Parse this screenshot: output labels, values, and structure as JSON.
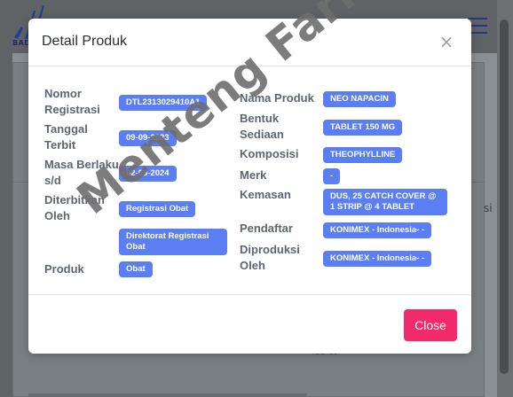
{
  "background": {
    "logo_text": "BAD",
    "side_text": "si",
    "footer_text": "Tablet"
  },
  "modal": {
    "title": "Detail Produk",
    "close_x": "×",
    "close_button": "Close"
  },
  "left_fields": [
    {
      "label": "Nomor Registrasi",
      "value": "DTL2313029410A1"
    },
    {
      "label": "Tanggal Terbit",
      "value": "09-09-2023"
    },
    {
      "label": "Masa Berlaku s/d",
      "value": "02-06-2024"
    },
    {
      "label": "Diterbitkan Oleh",
      "value": "Registrasi Obat",
      "value2": "Direktorat Registrasi Obat"
    },
    {
      "label": "Produk",
      "value": "Obat"
    }
  ],
  "right_fields": [
    {
      "label": "Nama Produk",
      "value": "NEO NAPACIN"
    },
    {
      "label": "Bentuk Sediaan",
      "value": "TABLET 150 MG"
    },
    {
      "label": "Komposisi",
      "value": "THEOPHYLLINE"
    },
    {
      "label": "Merk",
      "value": "-"
    },
    {
      "label": "Kemasan",
      "value": "DUS, 25 CATCH COVER @ 1 STRIP @ 4 TABLET"
    },
    {
      "label": "Pendaftar",
      "value": "KONIMEX - Indonesia- -"
    },
    {
      "label": "Diproduksi Oleh",
      "value": "KONIMEX - Indonesia- -"
    }
  ],
  "watermark": "Menteng Farma",
  "colors": {
    "badge": "#5b7ef2",
    "close_button": "#f2296a"
  }
}
